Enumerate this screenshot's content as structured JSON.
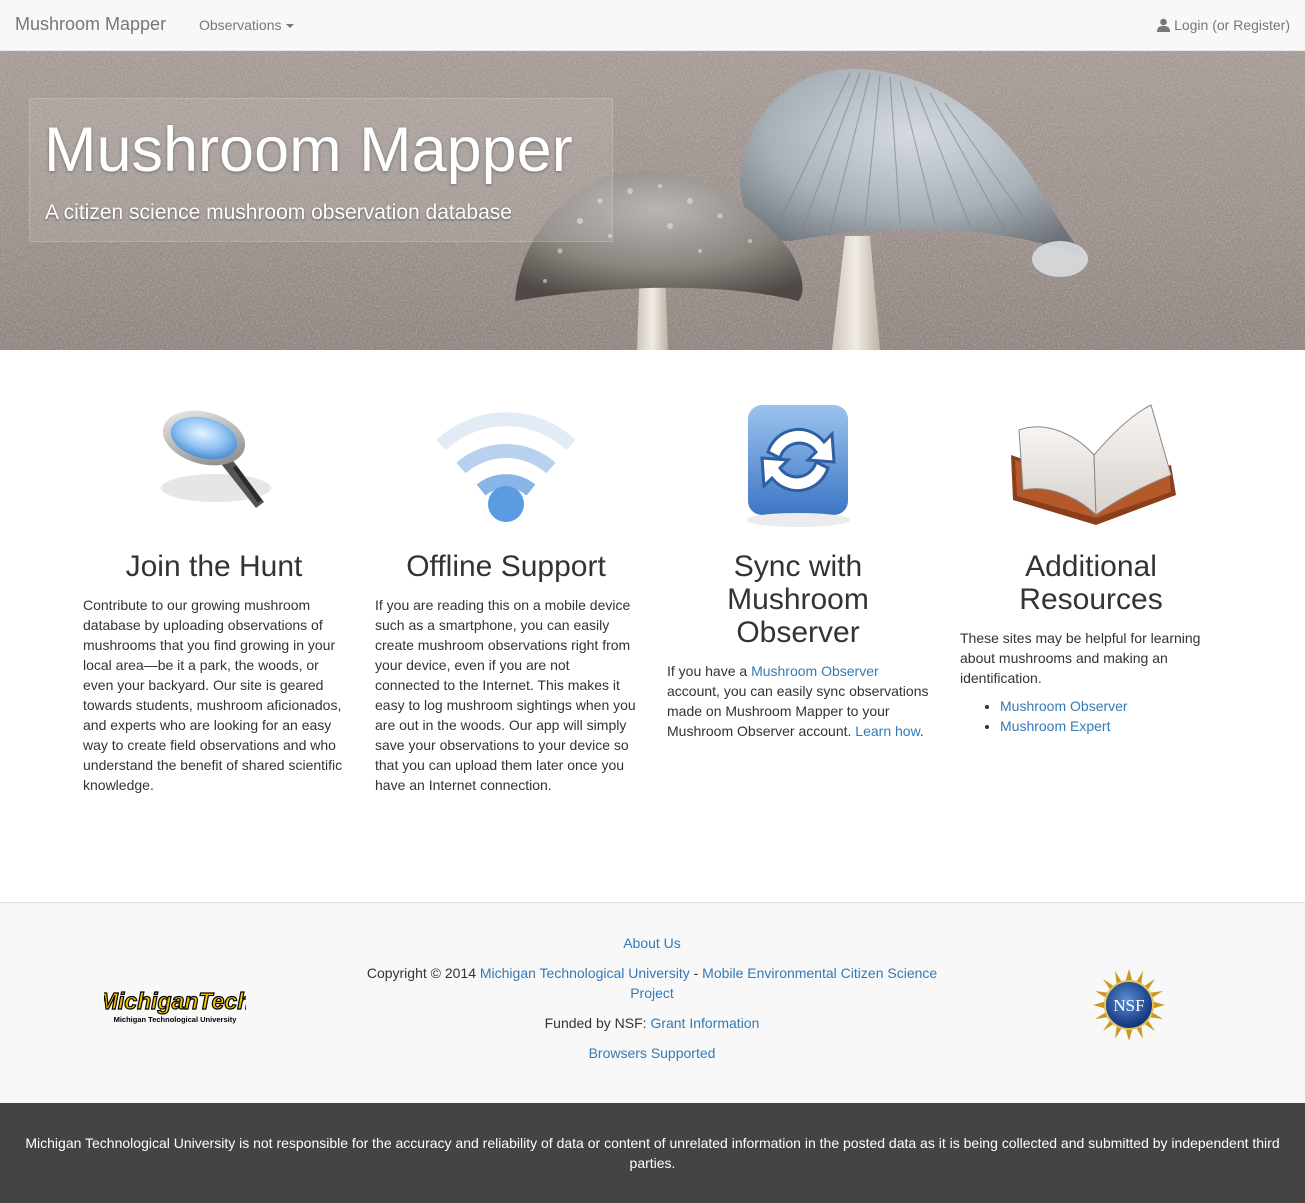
{
  "navbar": {
    "brand": "Mushroom Mapper",
    "observations_label": "Observations",
    "login_label": "Login (or Register)",
    "icons": {
      "caret": "caret-down-icon",
      "login": "user-icon"
    }
  },
  "hero": {
    "title": "Mushroom Mapper",
    "subtitle": "A citizen science mushroom observation database"
  },
  "features": {
    "hunt": {
      "icon": "magnifying-glass-icon",
      "title": "Join the Hunt",
      "body": "Contribute to our growing mushroom database by uploading observations of mushrooms that you find growing in your local area—be it a park, the woods, or even your backyard. Our site is geared towards students, mushroom aficionados, and experts who are looking for an easy way to create field observations and who understand the benefit of shared scientific knowledge."
    },
    "offline": {
      "icon": "wifi-icon",
      "title": "Offline Support",
      "body": "If you are reading this on a mobile device such as a smartphone, you can easily create mushroom observations right from your device, even if you are not connected to the Internet. This makes it easy to log mushroom sightings when you are out in the woods. Our app will simply save your observations to your device so that you can upload them later once you have an Internet connection."
    },
    "sync": {
      "icon": "sync-icon",
      "title_line1": "Sync with",
      "title_line2": "Mushroom",
      "title_line3": "Observer",
      "body_pre": "If you have a ",
      "body_link": "Mushroom Observer",
      "body_mid": " account, you can easily sync observations made on Mushroom Mapper to your Mushroom Observer account. ",
      "learn_link": "Learn how",
      "body_end": "."
    },
    "resources": {
      "icon": "book-icon",
      "title_line1": "Additional",
      "title_line2": "Resources",
      "body": "These sites may be helpful for learning about mushrooms and making an identification.",
      "links": [
        "Mushroom Observer",
        "Mushroom Expert"
      ]
    }
  },
  "footer": {
    "about_link": "About Us",
    "copyright_pre": "Copyright © 2014 ",
    "mtu_link": "Michigan Technological University",
    "separator": " - ",
    "mecs_link": "Mobile Environmental Citizen Science Project",
    "funded_pre": "Funded by NSF: ",
    "grant_link": "Grant Information",
    "browsers_link": "Browsers Supported",
    "mtu_logo_text": "MichiganTech",
    "mtu_logo_sub": "Michigan Technological University",
    "nsf_logo_text": "NSF"
  },
  "disclaimer": "Michigan Technological University is not responsible for the accuracy and reliability of data or content of unrelated information in the posted data as it is being collected and submitted by independent third parties."
}
